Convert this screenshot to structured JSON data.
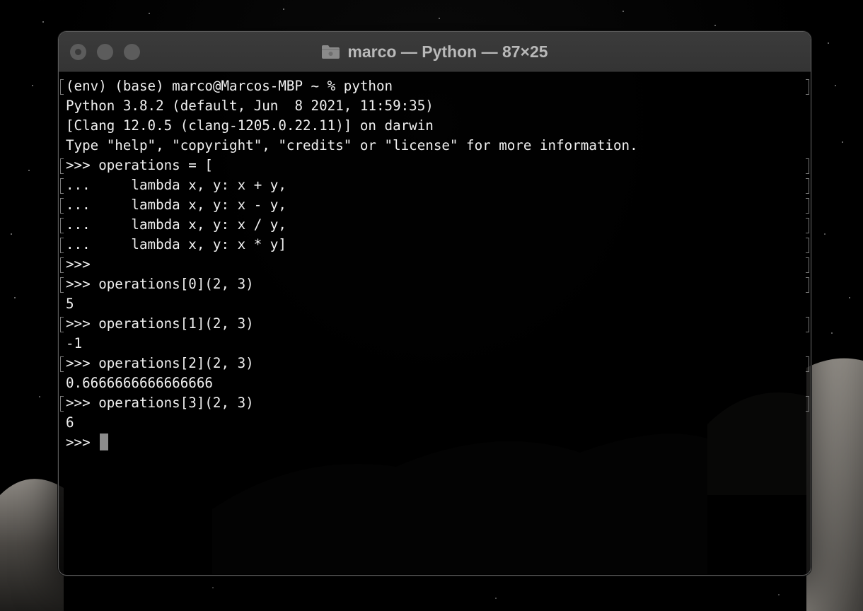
{
  "window": {
    "title": "marco — Python — 87×25",
    "folder_icon": "folder-icon"
  },
  "terminal": {
    "lines": [
      {
        "text": "(env) (base) marco@Marcos-MBP ~ % python",
        "marked": true
      },
      {
        "text": "Python 3.8.2 (default, Jun  8 2021, 11:59:35)",
        "marked": false
      },
      {
        "text": "[Clang 12.0.5 (clang-1205.0.22.11)] on darwin",
        "marked": false
      },
      {
        "text": "Type \"help\", \"copyright\", \"credits\" or \"license\" for more information.",
        "marked": false
      },
      {
        "text": ">>> operations = [",
        "marked": true
      },
      {
        "text": "...     lambda x, y: x + y,",
        "marked": true
      },
      {
        "text": "...     lambda x, y: x - y,",
        "marked": true
      },
      {
        "text": "...     lambda x, y: x / y,",
        "marked": true
      },
      {
        "text": "...     lambda x, y: x * y]",
        "marked": true
      },
      {
        "text": ">>>",
        "marked": true
      },
      {
        "text": ">>> operations[0](2, 3)",
        "marked": true
      },
      {
        "text": "5",
        "marked": false
      },
      {
        "text": ">>> operations[1](2, 3)",
        "marked": true
      },
      {
        "text": "-1",
        "marked": false
      },
      {
        "text": ">>> operations[2](2, 3)",
        "marked": true
      },
      {
        "text": "0.6666666666666666",
        "marked": false
      },
      {
        "text": ">>> operations[3](2, 3)",
        "marked": true
      },
      {
        "text": "6",
        "marked": false
      }
    ],
    "prompt": ">>> "
  },
  "colors": {
    "text": "#f0f0f0",
    "cursor": "#8c8c8c",
    "titlebar": "#383838"
  }
}
